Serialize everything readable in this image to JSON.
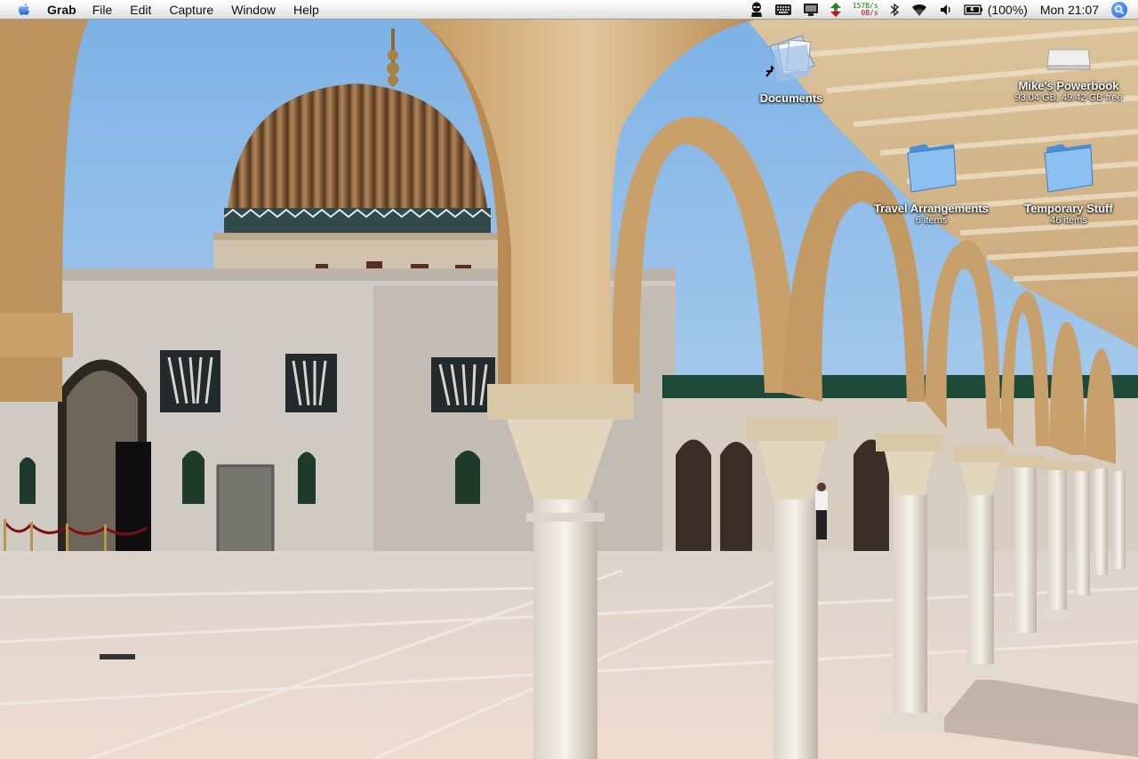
{
  "menubar": {
    "app_name": "Grab",
    "menus": [
      "File",
      "Edit",
      "Capture",
      "Window",
      "Help"
    ],
    "network": {
      "up": "157B/s",
      "down": "0B/s"
    },
    "battery": "(100%)",
    "clock": "Mon 21:07",
    "icons": [
      "apple-logo-icon",
      "alien-icon",
      "keyboard-icon",
      "display-icon",
      "sync-arrows-icon",
      "network-meter",
      "bluetooth-icon",
      "wifi-icon",
      "volume-icon",
      "battery-icon",
      "spotlight-icon"
    ]
  },
  "desktop": {
    "icons": [
      {
        "name": "Documents",
        "type": "alias-folder"
      },
      {
        "name": "Mike's Powerbook",
        "info": "93.04 GB, 49.42 GB free",
        "type": "drive"
      },
      {
        "name": "Travel Arrangements",
        "info": "6 items",
        "type": "folder"
      },
      {
        "name": "Temporary Stuff",
        "info": "46 items",
        "type": "folder"
      }
    ]
  },
  "colors": {
    "sky": "#8fbde8",
    "stone": "#d6b585",
    "plaza": "#e8d9cc",
    "folder_blue": "#6aa9e8"
  }
}
